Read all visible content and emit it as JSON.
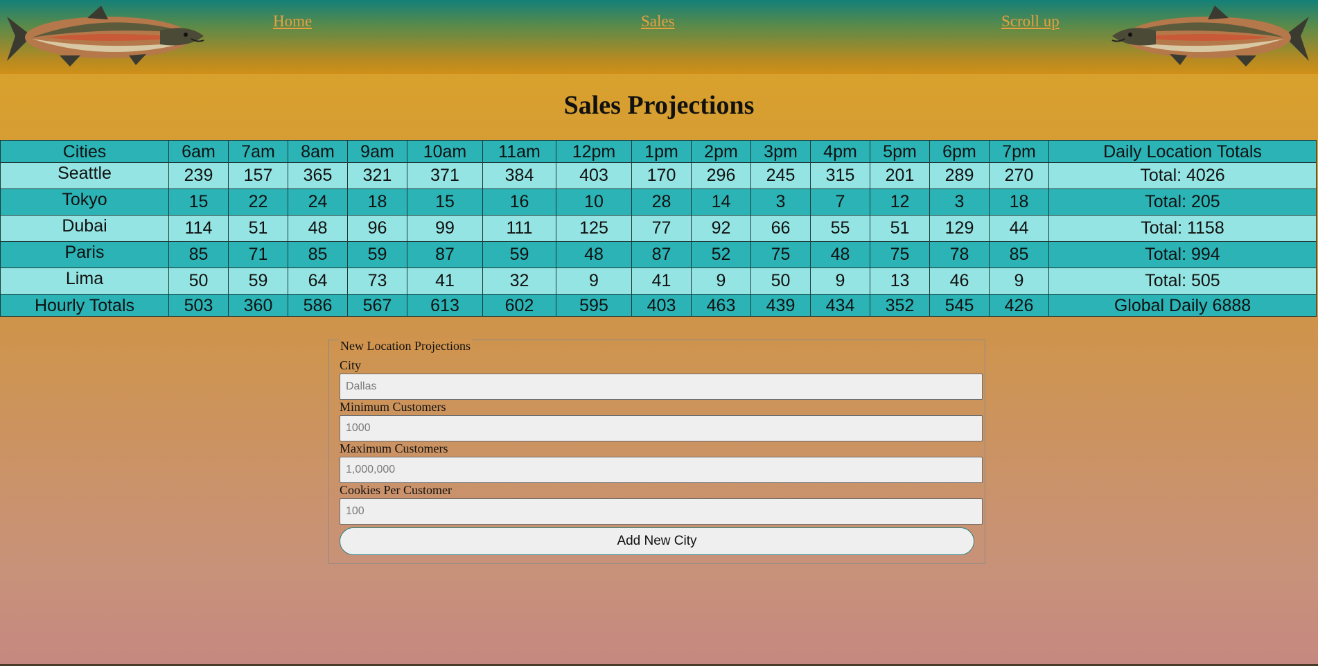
{
  "nav": {
    "home": "Home",
    "sales": "Sales",
    "scroll_up": "Scroll up"
  },
  "page_title": "Sales Projections",
  "table": {
    "headers": [
      "Cities",
      "6am",
      "7am",
      "8am",
      "9am",
      "10am",
      "11am",
      "12pm",
      "1pm",
      "2pm",
      "3pm",
      "4pm",
      "5pm",
      "6pm",
      "7pm",
      "Daily Location Totals"
    ],
    "rows": [
      {
        "city": "Seattle",
        "hours": [
          "239",
          "157",
          "365",
          "321",
          "371",
          "384",
          "403",
          "170",
          "296",
          "245",
          "315",
          "201",
          "289",
          "270"
        ],
        "total": "Total: 4026"
      },
      {
        "city": "Tokyo",
        "hours": [
          "15",
          "22",
          "24",
          "18",
          "15",
          "16",
          "10",
          "28",
          "14",
          "3",
          "7",
          "12",
          "3",
          "18"
        ],
        "total": "Total: 205"
      },
      {
        "city": "Dubai",
        "hours": [
          "114",
          "51",
          "48",
          "96",
          "99",
          "111",
          "125",
          "77",
          "92",
          "66",
          "55",
          "51",
          "129",
          "44"
        ],
        "total": "Total: 1158"
      },
      {
        "city": "Paris",
        "hours": [
          "85",
          "71",
          "85",
          "59",
          "87",
          "59",
          "48",
          "87",
          "52",
          "75",
          "48",
          "75",
          "78",
          "85"
        ],
        "total": "Total: 994"
      },
      {
        "city": "Lima",
        "hours": [
          "50",
          "59",
          "64",
          "73",
          "41",
          "32",
          "9",
          "41",
          "9",
          "50",
          "9",
          "13",
          "46",
          "9"
        ],
        "total": "Total: 505"
      }
    ],
    "footer": {
      "label": "Hourly Totals",
      "hours": [
        "503",
        "360",
        "586",
        "567",
        "613",
        "602",
        "595",
        "403",
        "463",
        "439",
        "434",
        "352",
        "545",
        "426"
      ],
      "total": "Global Daily 6888"
    }
  },
  "form": {
    "legend": "New Location Projections",
    "city_label": "City",
    "city_placeholder": "Dallas",
    "min_label": "Minimum Customers",
    "min_placeholder": "1000",
    "max_label": "Maximum Customers",
    "max_placeholder": "1,000,000",
    "cookies_label": "Cookies Per Customer",
    "cookies_placeholder": "100",
    "submit_label": "Add New City"
  },
  "colors": {
    "header_teal": "#148079",
    "header_gold": "#d09018",
    "link": "#e8a040",
    "row_dark": "#2bb3b5",
    "row_light": "#93e4e2"
  },
  "icons": [
    "salmon-fish-image-left",
    "salmon-fish-image-right"
  ]
}
